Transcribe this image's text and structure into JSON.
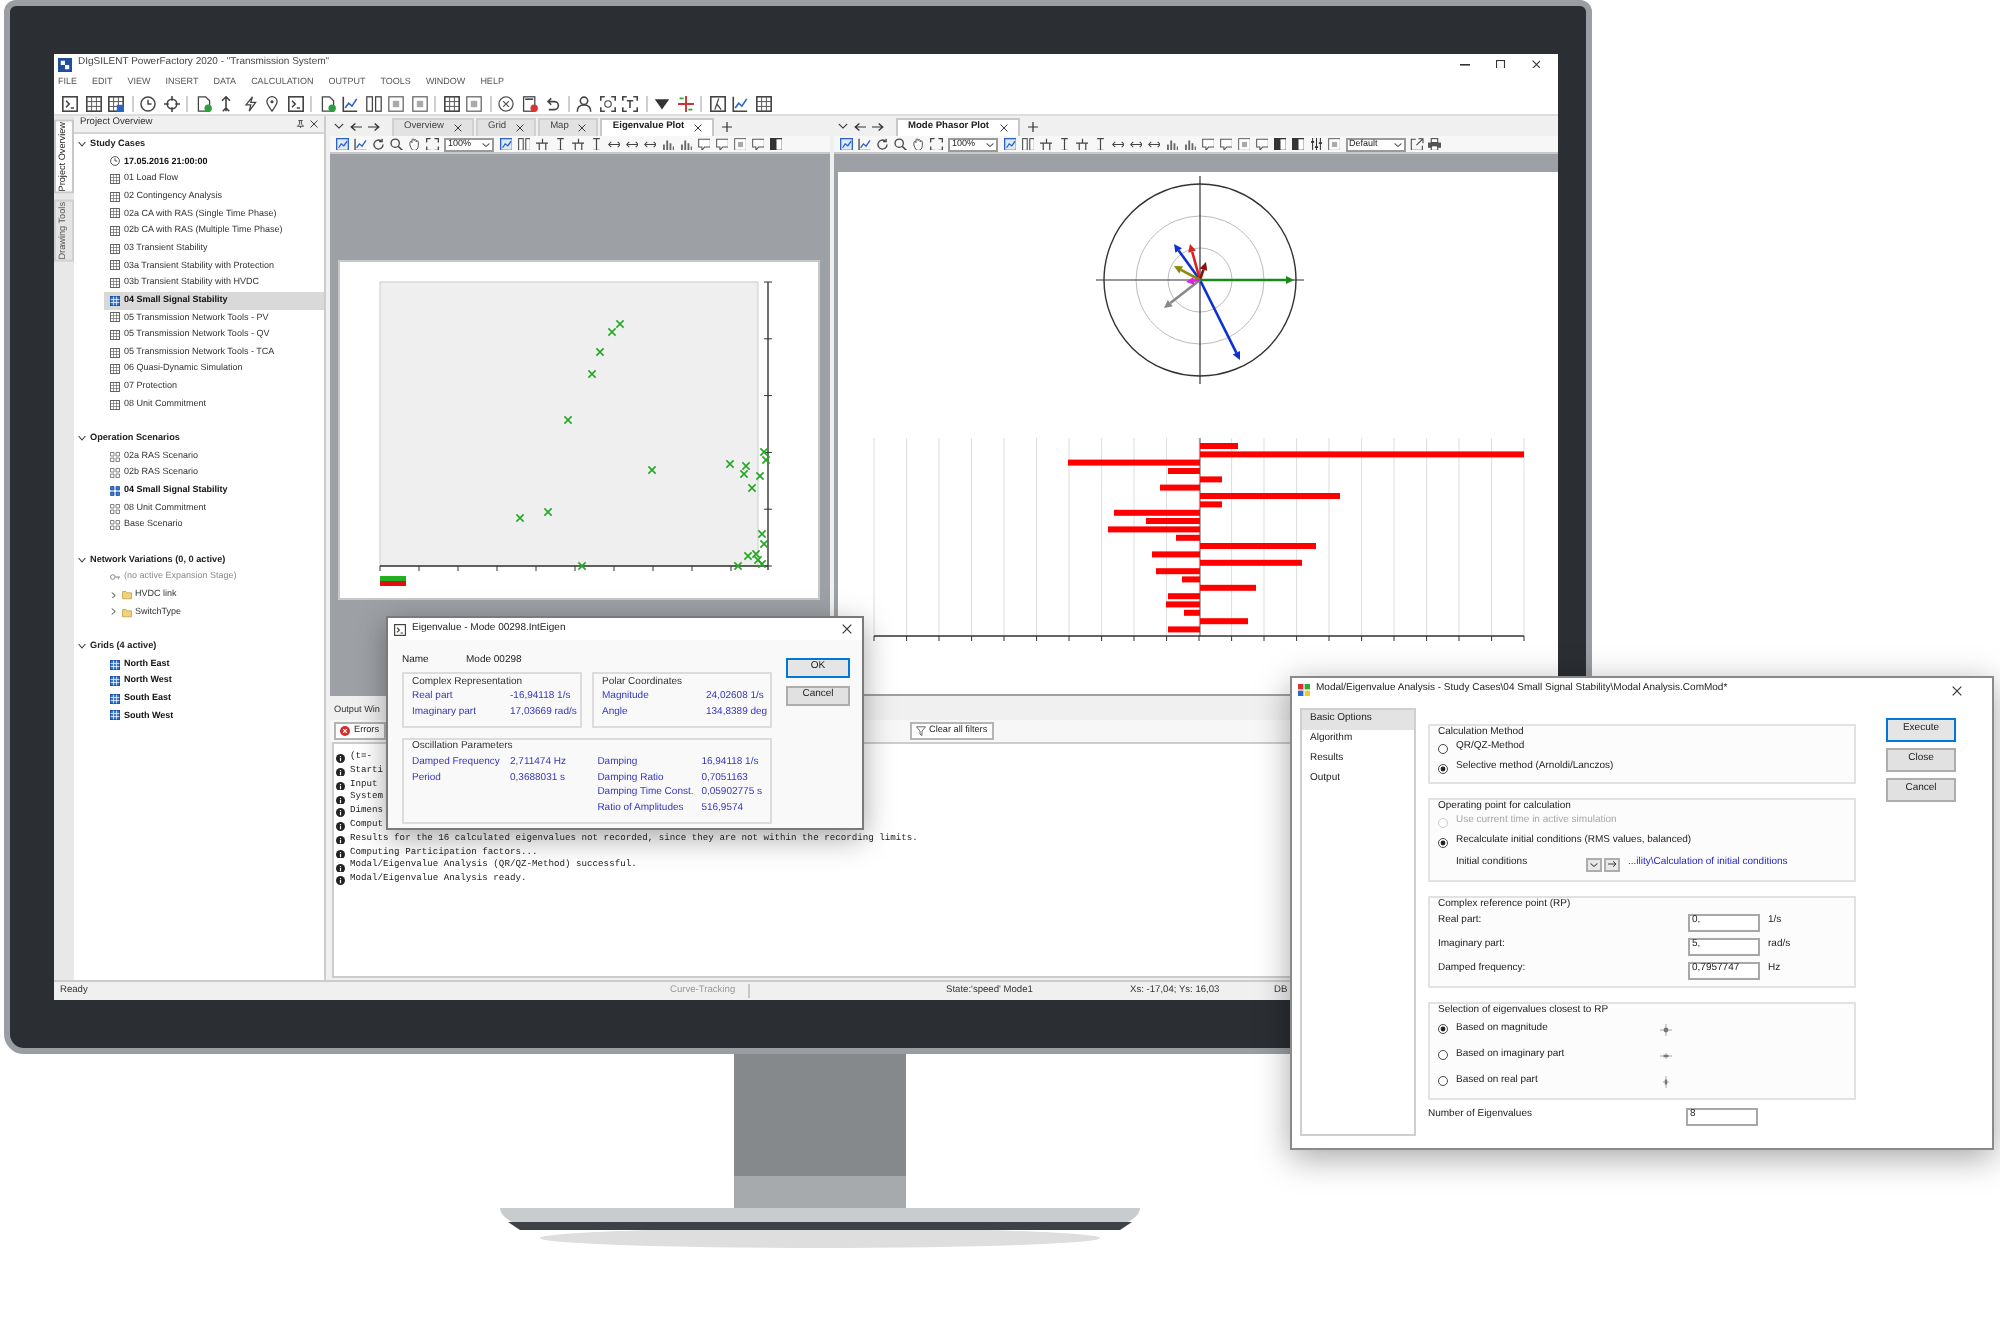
{
  "app": {
    "title": "DIgSILENT PowerFactory 2020 - \"Transmission System\"",
    "menu": [
      "FILE",
      "EDIT",
      "VIEW",
      "INSERT",
      "DATA",
      "CALCULATION",
      "OUTPUT",
      "TOOLS",
      "WINDOW",
      "HELP"
    ]
  },
  "side_tabs": [
    {
      "label": "Project Overview",
      "selected": true
    },
    {
      "label": "Drawing Tools",
      "selected": false
    }
  ],
  "project_overview": {
    "title": "Project Overview",
    "sections": [
      {
        "label": "Study Cases",
        "expanded": true,
        "children": [
          {
            "label": "17.05.2016 21:00:00",
            "kind": "time",
            "active": true,
            "selected": false
          },
          {
            "label": "01 Load Flow",
            "kind": "case",
            "active": false,
            "selected": false
          },
          {
            "label": "02 Contingency Analysis",
            "kind": "case",
            "active": false,
            "selected": false
          },
          {
            "label": "02a CA with RAS (Single Time Phase)",
            "kind": "case",
            "active": false,
            "selected": false
          },
          {
            "label": "02b CA with RAS (Multiple Time Phase)",
            "kind": "case",
            "active": false,
            "selected": false
          },
          {
            "label": "03 Transient Stability",
            "kind": "case",
            "active": false,
            "selected": false
          },
          {
            "label": "03a Transient Stability with Protection",
            "kind": "case",
            "active": false,
            "selected": false
          },
          {
            "label": "03b Transient Stability with HVDC",
            "kind": "case",
            "active": false,
            "selected": false
          },
          {
            "label": "04 Small Signal Stability",
            "kind": "case",
            "active": true,
            "selected": true
          },
          {
            "label": "05 Transmission Network Tools - PV",
            "kind": "case",
            "active": false,
            "selected": false
          },
          {
            "label": "05 Transmission Network Tools - QV",
            "kind": "case",
            "active": false,
            "selected": false
          },
          {
            "label": "05 Transmission Network Tools - TCA",
            "kind": "case",
            "active": false,
            "selected": false
          },
          {
            "label": "06 Quasi-Dynamic Simulation",
            "kind": "case",
            "active": false,
            "selected": false
          },
          {
            "label": "07 Protection",
            "kind": "case",
            "active": false,
            "selected": false
          },
          {
            "label": "08 Unit Commitment",
            "kind": "case",
            "active": false,
            "selected": false
          }
        ]
      },
      {
        "label": "Operation Scenarios",
        "expanded": true,
        "children": [
          {
            "label": "02a RAS Scenario",
            "kind": "scenario",
            "active": false,
            "selected": false
          },
          {
            "label": "02b RAS Scenario",
            "kind": "scenario",
            "active": false,
            "selected": false
          },
          {
            "label": "04 Small Signal Stability",
            "kind": "scenario",
            "active": true,
            "selected": false
          },
          {
            "label": "08 Unit Commitment",
            "kind": "scenario",
            "active": false,
            "selected": false
          },
          {
            "label": "Base Scenario",
            "kind": "scenario",
            "active": false,
            "selected": false
          }
        ]
      },
      {
        "label": "Network Variations (0, 0 active)",
        "expanded": true,
        "children": [
          {
            "label": "(no active Expansion Stage)",
            "kind": "stage",
            "active": false,
            "selected": false
          },
          {
            "label": "HVDC link",
            "kind": "variation",
            "expanded": false,
            "active": false,
            "selected": false
          },
          {
            "label": "SwitchType",
            "kind": "variation",
            "expanded": false,
            "active": false,
            "selected": false
          }
        ]
      },
      {
        "label": "Grids (4 active)",
        "expanded": true,
        "children": [
          {
            "label": "North East",
            "kind": "grid",
            "active": true,
            "selected": false
          },
          {
            "label": "North West",
            "kind": "grid",
            "active": true,
            "selected": false
          },
          {
            "label": "South East",
            "kind": "grid",
            "active": true,
            "selected": false
          },
          {
            "label": "South West",
            "kind": "grid",
            "active": true,
            "selected": false
          }
        ]
      }
    ]
  },
  "plots": {
    "left": {
      "tabs": [
        {
          "label": "Overview",
          "selected": false
        },
        {
          "label": "Grid",
          "selected": false
        },
        {
          "label": "Map",
          "selected": false
        },
        {
          "label": "Eigenvalue Plot",
          "selected": true
        }
      ],
      "zoom": "100%"
    },
    "right": {
      "tabs": [
        {
          "label": "Mode Phasor Plot",
          "selected": true
        }
      ],
      "zoom": "100%",
      "style": "Default"
    }
  },
  "output_window": {
    "title": "Output Win",
    "filters": [
      {
        "label": "Errors",
        "kind": "errors"
      },
      {
        "label": "Clear all filters",
        "kind": "clear"
      }
    ],
    "lines": [
      "(t=-",
      "Starti",
      "Input",
      "System",
      "Dimens",
      "Comput",
      "Results for the 16 calculated eigenvalues not recorded, since they are not within the recording limits.",
      "Computing Participation factors...",
      "Modal/Eigenvalue Analysis (QR/QZ-Method) successful.",
      "Modal/Eigenvalue Analysis ready."
    ]
  },
  "status_bar": [
    "Ready",
    "Curve-Tracking",
    "State:'speed' Mode1",
    "Xs: -17,04; Ys: 16,03",
    "DB"
  ],
  "eigen_dialog": {
    "title": "Eigenvalue - Mode 00298.IntEigen",
    "name_label": "Name",
    "name": "Mode 00298",
    "group_rows": [
      [
        {
          "title": "Complex Representation",
          "columns": [
            [
              {
                "label": "Real part",
                "value": "-16,94118 1/s"
              },
              {
                "label": "Imaginary part",
                "value": "17,03669 rad/s"
              }
            ]
          ]
        },
        {
          "title": "Polar Coordinates",
          "columns": [
            [
              {
                "label": "Magnitude",
                "value": "24,02608 1/s"
              },
              {
                "label": "Angle",
                "value": "134,8389 deg"
              }
            ]
          ]
        }
      ],
      [
        {
          "title": "Oscillation Parameters",
          "columns": [
            [
              {
                "label": "Damped Frequency",
                "value": "2,711474 Hz"
              },
              {
                "label": "Period",
                "value": "0,3688031 s"
              }
            ],
            [
              {
                "label": "Damping",
                "value": "16,94118 1/s"
              },
              {
                "label": "Damping Ratio",
                "value": "0,7051163"
              },
              {
                "label": "Damping Time Const.",
                "value": "0,05902775 s"
              },
              {
                "label": "Ratio of Amplitudes",
                "value": "516,9574"
              }
            ]
          ]
        }
      ]
    ],
    "buttons": [
      {
        "label": "OK",
        "default": true
      },
      {
        "label": "Cancel",
        "default": false
      }
    ]
  },
  "modal_dialog": {
    "title": "Modal/Eigenvalue Analysis - Study Cases\\04 Small Signal Stability\\Modal Analysis.ComMod*",
    "pages": [
      {
        "label": "Basic Options",
        "selected": true
      },
      {
        "label": "Algorithm",
        "selected": false
      },
      {
        "label": "Results",
        "selected": false
      },
      {
        "label": "Output",
        "selected": false
      }
    ],
    "sections": [
      {
        "title": "Calculation Method",
        "fields": [
          {
            "kind": "radio",
            "label": "QR/QZ-Method",
            "checked": false,
            "disabled": false
          },
          {
            "kind": "radio",
            "label": "Selective method (Arnoldi/Lanczos)",
            "checked": true,
            "disabled": false
          }
        ]
      },
      {
        "title": "Operating point for calculation",
        "fields": [
          {
            "kind": "radio",
            "label": "Use current time in active simulation",
            "checked": false,
            "disabled": true
          },
          {
            "kind": "radio",
            "label": "Recalculate initial conditions (RMS values, balanced)",
            "checked": true,
            "disabled": false
          },
          {
            "kind": "reference",
            "label": "Initial conditions",
            "link": "...ility\\Calculation of initial conditions"
          }
        ]
      },
      {
        "title": "Complex reference point (RP)",
        "fields": [
          {
            "kind": "input",
            "label": "Real part:",
            "value": "0,",
            "unit": "1/s"
          },
          {
            "kind": "input",
            "label": "Imaginary part:",
            "value": "5,",
            "unit": "rad/s"
          },
          {
            "kind": "input",
            "label": "Damped frequency:",
            "value": "0,7957747",
            "unit": "Hz"
          }
        ]
      },
      {
        "title": "Selection of eigenvalues closest to RP",
        "fields": [
          {
            "kind": "radio_icon",
            "label": "Based on magnitude",
            "checked": true,
            "disabled": false
          },
          {
            "kind": "radio_icon",
            "label": "Based on imaginary part",
            "checked": false,
            "disabled": false
          },
          {
            "kind": "radio_icon",
            "label": "Based on real part",
            "checked": false,
            "disabled": false
          }
        ]
      }
    ],
    "number": {
      "label": "Number of Eigenvalues",
      "value": "8"
    },
    "buttons": [
      {
        "label": "Execute",
        "default": true
      },
      {
        "label": "Close",
        "default": false
      },
      {
        "label": "Cancel",
        "default": false
      }
    ]
  }
}
